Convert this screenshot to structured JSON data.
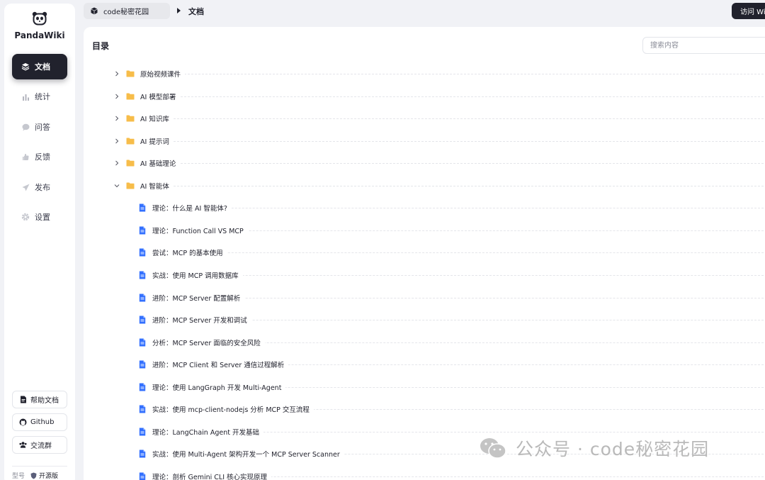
{
  "app": {
    "name": "PandaWiki"
  },
  "sidebar": {
    "items": [
      {
        "label": "文档",
        "icon": "layers-icon",
        "active": true
      },
      {
        "label": "统计",
        "icon": "bar-chart-icon"
      },
      {
        "label": "问答",
        "icon": "chat-bubble-icon"
      },
      {
        "label": "反馈",
        "icon": "hand-icon"
      },
      {
        "label": "发布",
        "icon": "send-icon"
      },
      {
        "label": "设置",
        "icon": "gear-icon"
      }
    ],
    "buttons": [
      {
        "label": "帮助文档",
        "icon": "document-icon"
      },
      {
        "label": "Github",
        "icon": "github-icon"
      },
      {
        "label": "交流群",
        "icon": "group-icon"
      }
    ],
    "version_label": "型号",
    "edition_label": "开源版"
  },
  "topbar": {
    "breadcrumb_root": "code秘密花园",
    "breadcrumb_current": "文档",
    "visit_label": "访问 Wi"
  },
  "main": {
    "title": "目录",
    "search_placeholder": "搜索内容",
    "folders": [
      {
        "label": "原始视频课件",
        "expanded": false
      },
      {
        "label": "AI 模型部署",
        "expanded": false
      },
      {
        "label": "AI 知识库",
        "expanded": false
      },
      {
        "label": "AI 提示词",
        "expanded": false
      },
      {
        "label": "AI 基础理论",
        "expanded": false
      },
      {
        "label": "AI 智能体",
        "expanded": true
      }
    ],
    "documents": [
      "理论：什么是 AI 智能体?",
      "理论：Function Call VS MCP",
      "尝试：MCP 的基本使用",
      "实战：使用 MCP 调用数据库",
      "进阶：MCP Server 配置解析",
      "进阶：MCP Server 开发和调试",
      "分析：MCP Server 面临的安全风险",
      "进阶：MCP Client 和 Server 通信过程解析",
      "理论：使用 LangGraph 开发 Multi-Agent",
      "实战：使用 mcp-client-nodejs 分析 MCP 交互流程",
      "理论：LangChain Agent 开发基础",
      "实战：使用 Multi-Agent 架构开发一个 MCP Server Scanner",
      "理论：剖析 Gemini CLI 核心实现原理"
    ]
  },
  "watermark": {
    "text": "公众号 · code秘密花园"
  },
  "colors": {
    "accent": "#21222d",
    "folder": "#f7bd4a",
    "doc": "#3370ff"
  }
}
